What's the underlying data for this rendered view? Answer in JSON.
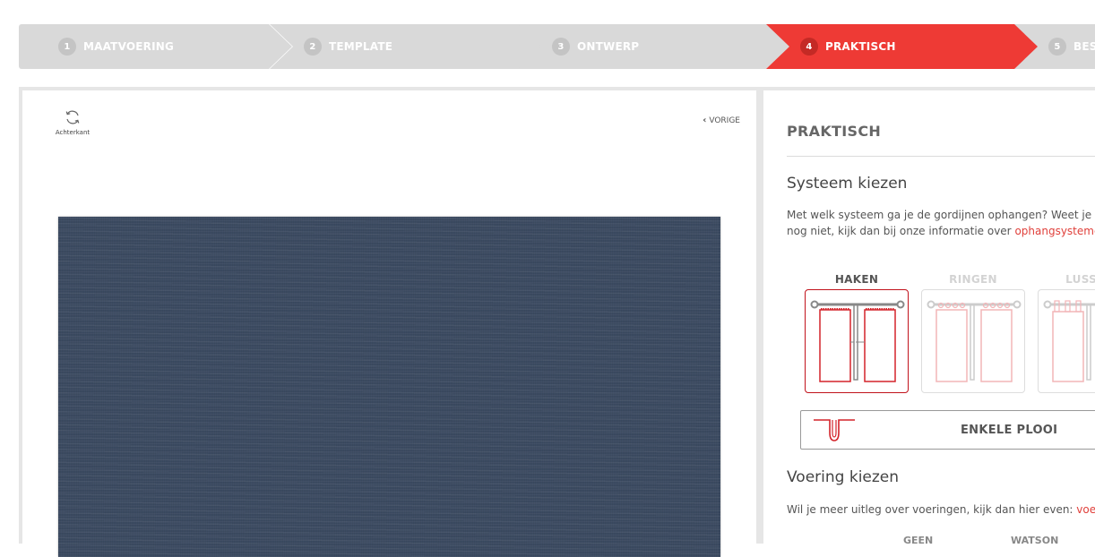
{
  "steps": [
    {
      "num": "1",
      "label": "MAATVOERING",
      "active": false
    },
    {
      "num": "2",
      "label": "TEMPLATE",
      "active": false
    },
    {
      "num": "3",
      "label": "ONTWERP",
      "active": false
    },
    {
      "num": "4",
      "label": "PRAKTISCH",
      "active": true
    },
    {
      "num": "5",
      "label": "BESTELLEN",
      "active": false
    }
  ],
  "preview": {
    "backside_label": "Achterkant",
    "prev_label": "VORIGE",
    "fabric_color": "#3c4b62"
  },
  "panel": {
    "title": "PRAKTISCH",
    "system": {
      "heading": "Systeem kiezen",
      "text_line1": "Met welk systeem ga je de gordijnen ophangen? Weet je het",
      "text_line2_prefix": "nog niet, kijk dan bij onze informatie over ",
      "text_line2_link": "ophangsystemen",
      "options": [
        {
          "label": "HAKEN",
          "selected": true
        },
        {
          "label": "RINGEN",
          "selected": false
        },
        {
          "label": "LUSSEN",
          "selected": false
        }
      ],
      "pleat_label": "ENKELE PLOOI"
    },
    "lining": {
      "heading": "Voering kiezen",
      "text_prefix": "Wil je meer uitleg over voeringen, kijk dan hier even: ",
      "text_link": "voeringen",
      "options": [
        "GEEN",
        "WATSON"
      ]
    }
  },
  "colors": {
    "accent": "#ee3a35",
    "step_inactive": "#d9d9d9",
    "selected_border": "#c1121b"
  }
}
